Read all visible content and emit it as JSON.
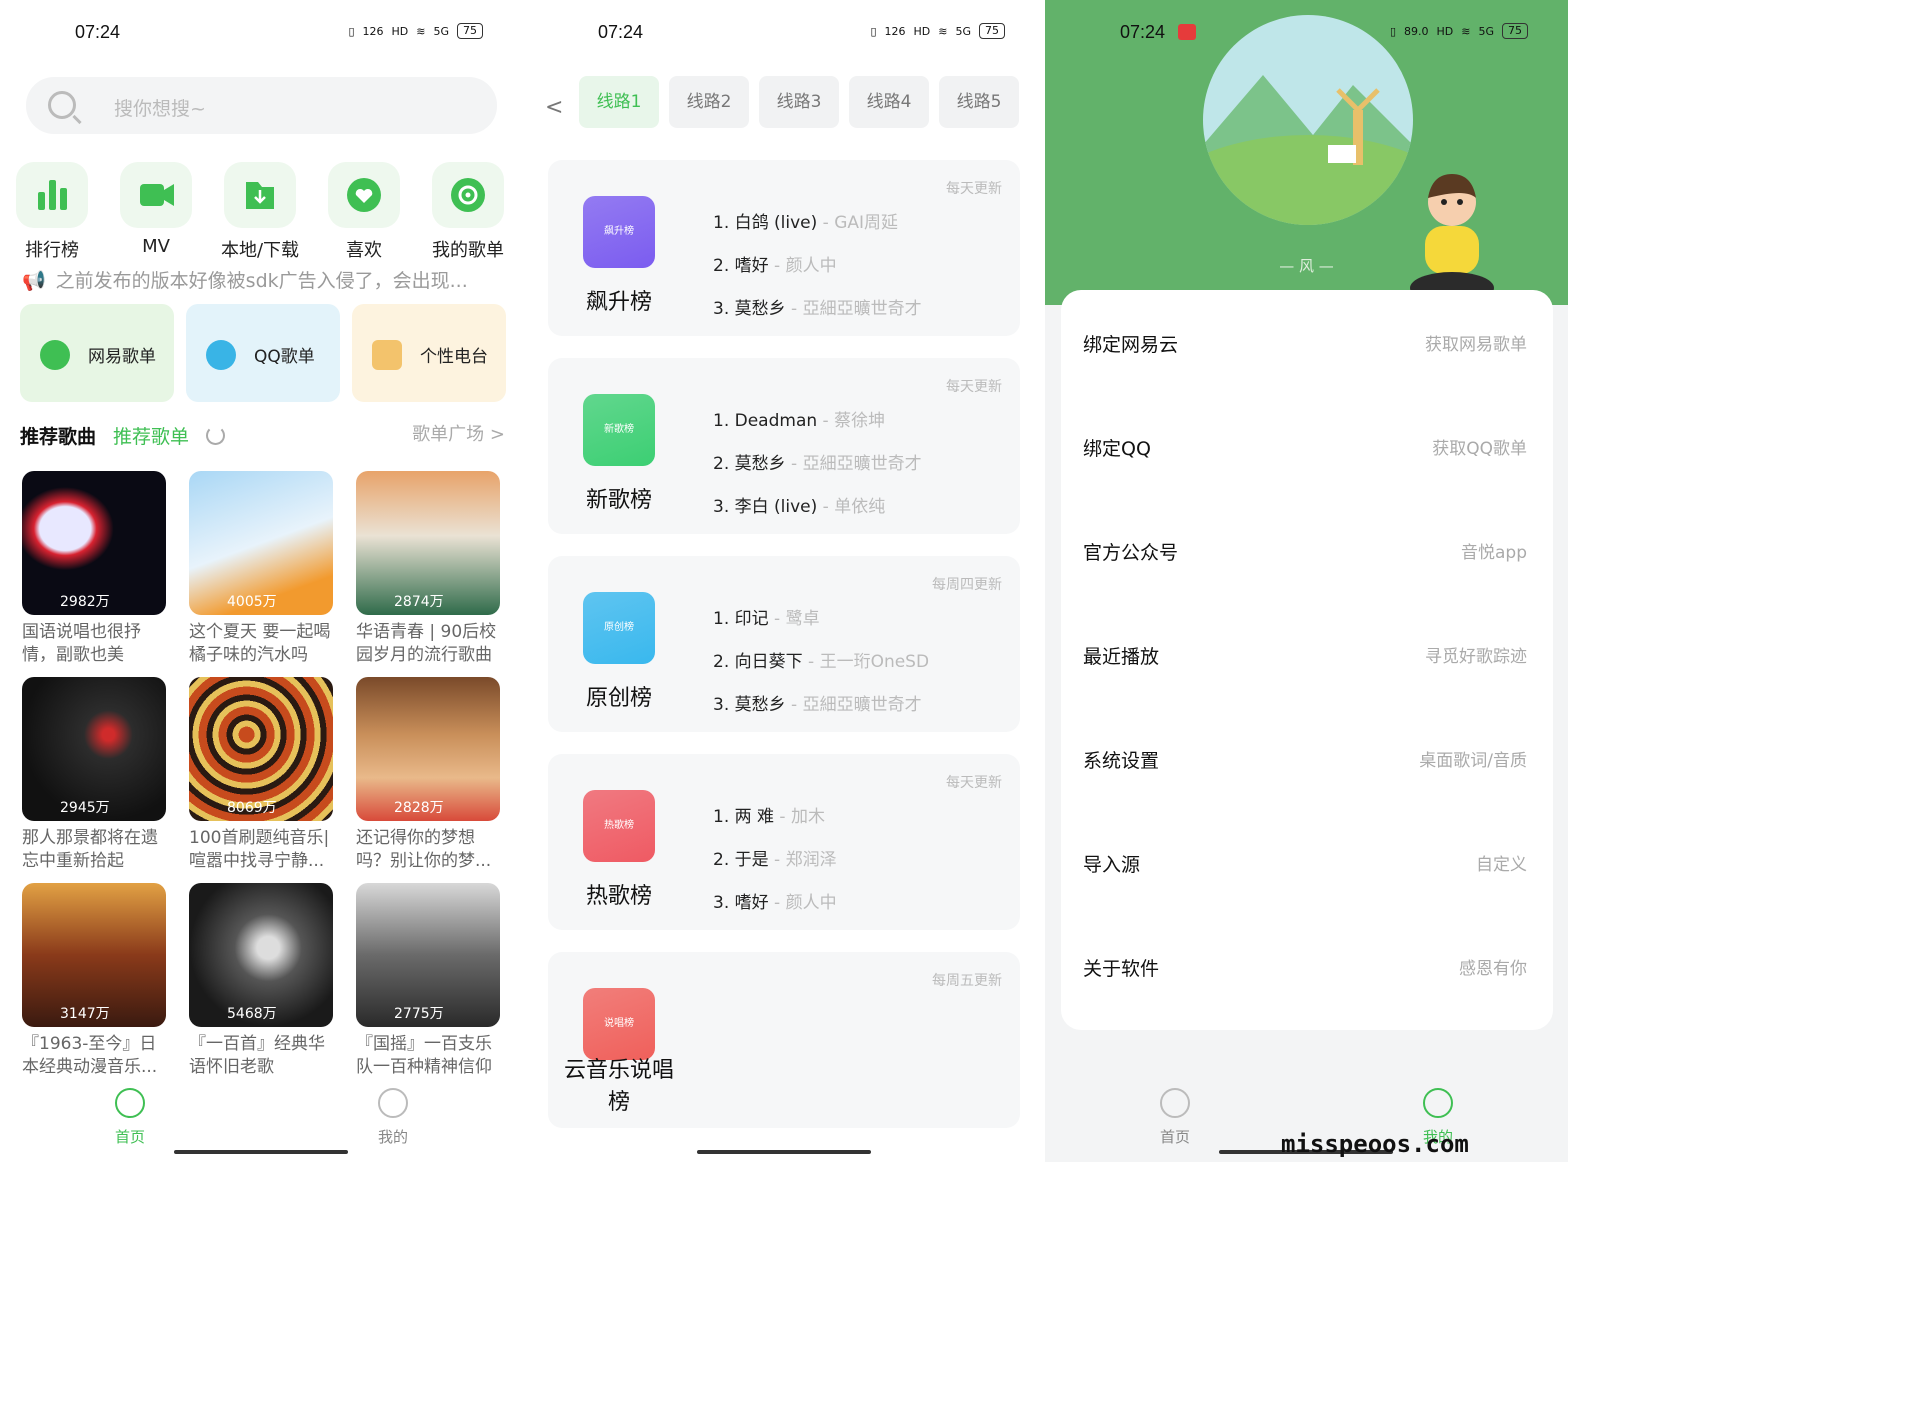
{
  "status": {
    "time": "07:24",
    "speed": "126",
    "speed_unit": "KB/S",
    "speed2": "89.0",
    "hd": "HD",
    "net": "5G",
    "battery": "75"
  },
  "home": {
    "search_placeholder": "搜你想搜~",
    "categories": [
      "排行榜",
      "MV",
      "本地/下载",
      "喜欢",
      "我的歌单"
    ],
    "notice": "之前发布的版本好像被sdk广告入侵了，会出现...",
    "sources": [
      "网易歌单",
      "QQ歌单",
      "个性电台"
    ],
    "rec_title": "推荐歌曲",
    "rec_tab": "推荐歌单",
    "more": "歌单广场 >",
    "cards": [
      {
        "plays": "2982万",
        "title": "国语说唱也很抒情，副歌也美"
      },
      {
        "plays": "4005万",
        "title": "这个夏天 要一起喝橘子味的汽水吗"
      },
      {
        "plays": "2874万",
        "title": "华语青春 | 90后校园岁月的流行歌曲"
      },
      {
        "plays": "2945万",
        "title": "那人那景都将在遗忘中重新拾起"
      },
      {
        "plays": "8069万",
        "title": "100首刷题纯音乐|喧嚣中找寻宁静..."
      },
      {
        "plays": "2828万",
        "title": "还记得你的梦想吗？别让你的梦..."
      },
      {
        "plays": "3147万",
        "title": "『1963-至今』日本经典动漫音乐..."
      },
      {
        "plays": "5468万",
        "title": "『一百首』经典华语怀旧老歌"
      },
      {
        "plays": "2775万",
        "title": "『国摇』一百支乐队一百种精神信仰"
      }
    ],
    "tabs": [
      "首页",
      "我的"
    ]
  },
  "charts": {
    "lines": [
      "线路1",
      "线路2",
      "线路3",
      "线路4",
      "线路5"
    ],
    "ranks": [
      {
        "logo": "飙升榜",
        "name": "飙升榜",
        "update": "每天更新",
        "color": "#7b5cf0",
        "songs": [
          [
            "1. 白鸽 (live)",
            " - GAI周延"
          ],
          [
            "2. 嗜好",
            " - 颜人中"
          ],
          [
            "3. 莫愁乡",
            " - 亞細亞曠世奇才"
          ]
        ]
      },
      {
        "logo": "新歌榜",
        "name": "新歌榜",
        "update": "每天更新",
        "color": "#3ccf73",
        "songs": [
          [
            "1. Deadman",
            " - 蔡徐坤"
          ],
          [
            "2. 莫愁乡",
            " - 亞細亞曠世奇才"
          ],
          [
            "3. 李白 (live)",
            " - 单依纯"
          ]
        ]
      },
      {
        "logo": "原创榜",
        "name": "原创榜",
        "update": "每周四更新",
        "color": "#39b8ee",
        "songs": [
          [
            "1. 印记",
            " - 鹭卓"
          ],
          [
            "2. 向日葵下",
            " - 王一珩OneSD"
          ],
          [
            "3. 莫愁乡",
            " - 亞細亞曠世奇才"
          ]
        ]
      },
      {
        "logo": "热歌榜",
        "name": "热歌榜",
        "update": "每天更新",
        "color": "#ef5a63",
        "songs": [
          [
            "1. 两 难",
            " - 加木"
          ],
          [
            "2. 于是",
            " - 郑润泽"
          ],
          [
            "3. 嗜好",
            " - 颜人中"
          ]
        ]
      },
      {
        "logo": "说唱榜",
        "name": "云音乐说唱榜",
        "update": "每周五更新",
        "color": "#f0605b",
        "songs": []
      }
    ]
  },
  "mine": {
    "nickname": "—   风   —",
    "menu": [
      {
        "left": "绑定网易云",
        "right": "获取网易歌单"
      },
      {
        "left": "绑定QQ",
        "right": "获取QQ歌单"
      },
      {
        "left": "官方公众号",
        "right": "音悦app"
      },
      {
        "left": "最近播放",
        "right": "寻觅好歌踪迹"
      },
      {
        "left": "系统设置",
        "right": "桌面歌词/音质"
      },
      {
        "left": "导入源",
        "right": "自定义"
      },
      {
        "left": "关于软件",
        "right": "感恩有你"
      }
    ],
    "tabs": [
      "首页",
      "我的"
    ],
    "watermark": "misspeoos.com"
  },
  "colors": {
    "accent": "#3fbf53",
    "header_green": "#62b26a"
  }
}
